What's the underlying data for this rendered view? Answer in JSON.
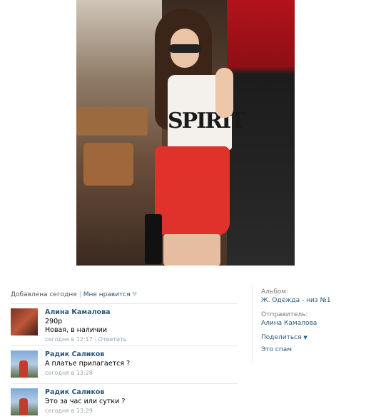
{
  "photo": {
    "shirt_text": "SPIRIT"
  },
  "meta": {
    "added": "Добавлена сегодня",
    "sep": "|",
    "like": "Мне нравится",
    "heart_icon": "heart-icon"
  },
  "comments": [
    {
      "author": "Алина Камалова",
      "lines": [
        "290р",
        "Новая, в наличии"
      ],
      "date": "сегодня в 12:17",
      "reply": "Ответить"
    },
    {
      "author": "Радик Саликов",
      "lines": [
        "А платье прилагается ?"
      ],
      "date": "сегодня в 13:28",
      "reply": ""
    },
    {
      "author": "Радик Саликов",
      "lines": [
        "Это за час или сутки ?"
      ],
      "date": "сегодня в 13:29",
      "reply": ""
    }
  ],
  "sidebar": {
    "album_label": "Альбом:",
    "album_value": "Ж. Одежда - низ №1",
    "sender_label": "Отправитель:",
    "sender_value": "Алина Камалова",
    "share": "Поделиться",
    "spam": "Это спам"
  }
}
